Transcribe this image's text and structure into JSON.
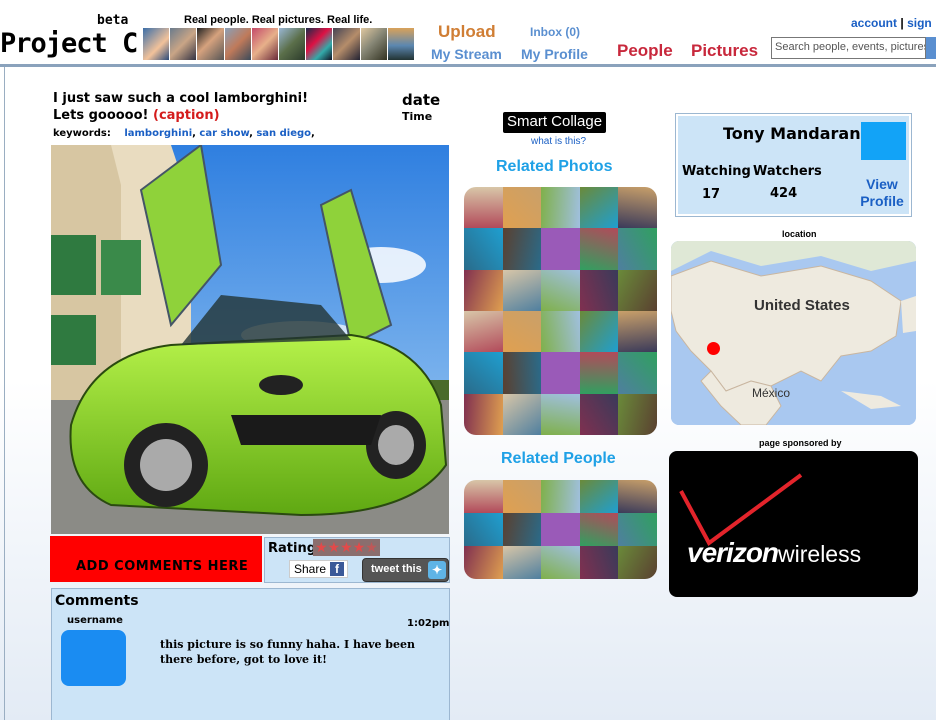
{
  "header": {
    "logo_beta": "beta",
    "logo": "Project C",
    "tagline": "Real people. Real pictures. Real life.",
    "nav": {
      "upload": "Upload",
      "my_stream": "My Stream",
      "inbox": "Inbox (0)",
      "my_profile": "My Profile",
      "people": "People",
      "pictures": "Pictures"
    },
    "account": "account",
    "separator": "|",
    "sign": "sign",
    "search_placeholder": "Search people, events, pictures"
  },
  "post": {
    "title_line1": "I just saw such a cool lamborghini!",
    "title_line2": "Lets gooooo!",
    "caption": "(caption)",
    "date_label": "date",
    "time_label": "Time",
    "keywords_label": "keywords:",
    "keywords": [
      "lamborghini",
      "car show",
      "san diego"
    ]
  },
  "actions": {
    "add_comments": "ADD COMMENTS HERE",
    "rating_label": "Rating",
    "rating": 4.5,
    "rating_max": 5,
    "share_label": "Share",
    "tweet_label": "tweet this"
  },
  "comments": {
    "title": "Comments",
    "items": [
      {
        "username": "username",
        "time": "1:02pm",
        "text": "this picture is so funny haha. I have been there before, got to love it!"
      }
    ]
  },
  "collage": {
    "smart_label": "Smart Collage",
    "what_is_this": "what is this?",
    "related_photos": "Related Photos",
    "related_people": "Related People"
  },
  "profile": {
    "name": "Tony Mandarano",
    "watching_label": "Watching",
    "watching_count": "17",
    "watchers_label": "Watchers",
    "watchers_count": "424",
    "view_profile": "View Profile"
  },
  "location": {
    "label": "location",
    "map_country": "United States",
    "map_mexico": "México"
  },
  "sponsor": {
    "label": "page sponsored by",
    "brand_main": "verizon",
    "brand_sub": "wireless"
  },
  "colors": {
    "link_blue": "#1a5fc4",
    "nav_orange": "#d07e34",
    "nav_red": "#c8283c",
    "panel_blue": "#cce4f7",
    "section_blue": "#1fa1e6",
    "comment_red": "#ff0000",
    "car_green": "#7ed321"
  },
  "icons": {
    "facebook": "facebook-icon",
    "twitter": "twitter-icon",
    "map_pin": "map-pin-icon"
  }
}
